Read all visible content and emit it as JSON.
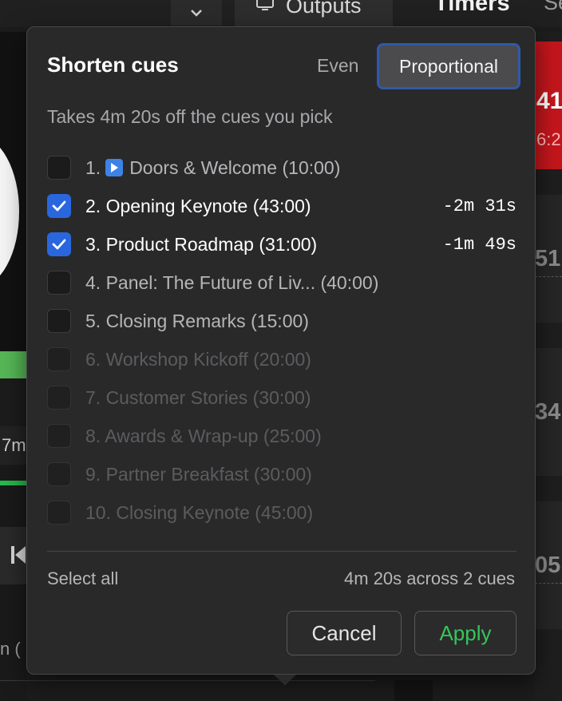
{
  "background": {
    "tabs": {
      "outputs_label": "Outputs",
      "timers_label": "Timers",
      "settings_label_partial": "Se"
    },
    "left_time_partial": "7m",
    "left_bottom_partial": "n (",
    "right_values": [
      "41",
      "6:2",
      "51",
      "34",
      "05"
    ]
  },
  "popover": {
    "title": "Shorten cues",
    "modes": {
      "even_label": "Even",
      "proportional_label": "Proportional",
      "active": "Proportional"
    },
    "subtitle": "Takes 4m 20s off the cues you pick",
    "cues": [
      {
        "label": "1. Doors & Welcome (10:00)",
        "checked": false,
        "state": "enabled",
        "delta": "",
        "icon": "play-icon"
      },
      {
        "label": "2. Opening Keynote (43:00)",
        "checked": true,
        "state": "enabled",
        "delta": "-2m 31s"
      },
      {
        "label": "3. Product Roadmap (31:00)",
        "checked": true,
        "state": "enabled",
        "delta": "-1m 49s"
      },
      {
        "label": "4. Panel: The Future of Liv... (40:00)",
        "checked": false,
        "state": "enabled",
        "delta": ""
      },
      {
        "label": "5. Closing Remarks (15:00)",
        "checked": false,
        "state": "enabled",
        "delta": ""
      },
      {
        "label": "6. Workshop Kickoff (20:00)",
        "checked": false,
        "state": "disabled",
        "delta": ""
      },
      {
        "label": "7. Customer Stories (30:00)",
        "checked": false,
        "state": "disabled",
        "delta": ""
      },
      {
        "label": "8. Awards & Wrap-up (25:00)",
        "checked": false,
        "state": "disabled",
        "delta": ""
      },
      {
        "label": "9. Partner Breakfast (30:00)",
        "checked": false,
        "state": "disabled",
        "delta": ""
      },
      {
        "label": "10. Closing Keynote (45:00)",
        "checked": false,
        "state": "disabled",
        "delta": ""
      }
    ],
    "footer": {
      "select_all_label": "Select all",
      "summary": "4m 20s across 2 cues"
    },
    "buttons": {
      "cancel_label": "Cancel",
      "apply_label": "Apply"
    }
  },
  "colors": {
    "accent_blue": "#2a67de",
    "apply_green": "#34c759",
    "live_red": "#c4161c",
    "progress_green": "#26b84a"
  }
}
